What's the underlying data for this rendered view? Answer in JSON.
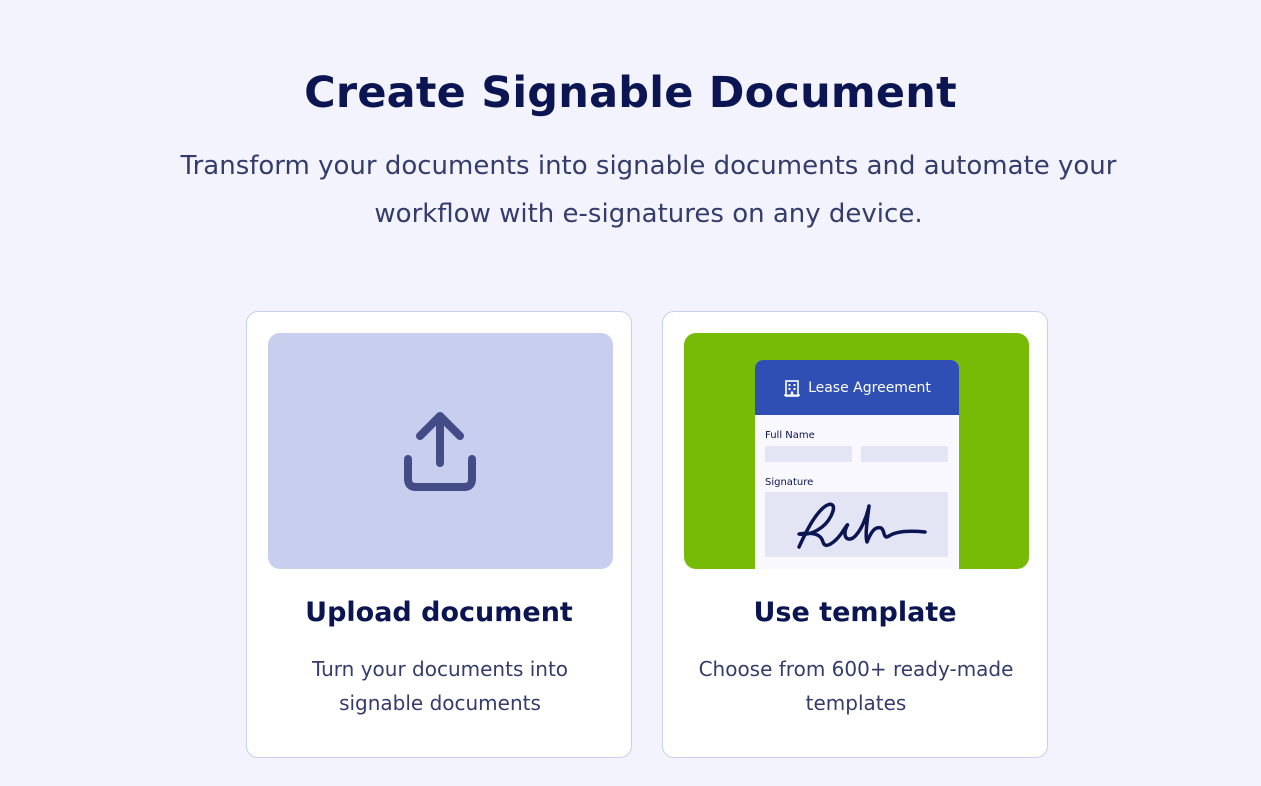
{
  "header": {
    "title": "Create Signable Document",
    "subtitle": "Transform your documents into signable documents and automate your workflow with e-signatures on any device."
  },
  "cards": [
    {
      "id": "upload",
      "title": "Upload document",
      "description": "Turn your documents into signable documents",
      "icon": "upload-icon",
      "media_color": "#c8ceed"
    },
    {
      "id": "template",
      "title": "Use template",
      "description": "Choose from 600+ ready-made templates",
      "media_color": "#78bb07",
      "preview": {
        "doc_title": "Lease Agreement",
        "doc_icon": "building-icon",
        "full_name_label": "Full Name",
        "signature_label": "Signature",
        "header_color": "#2f4fb5"
      }
    }
  ],
  "colors": {
    "background": "#f3f3fe",
    "heading": "#0a1551",
    "body_text": "#343c6a",
    "card_border": "#c8ceed"
  }
}
